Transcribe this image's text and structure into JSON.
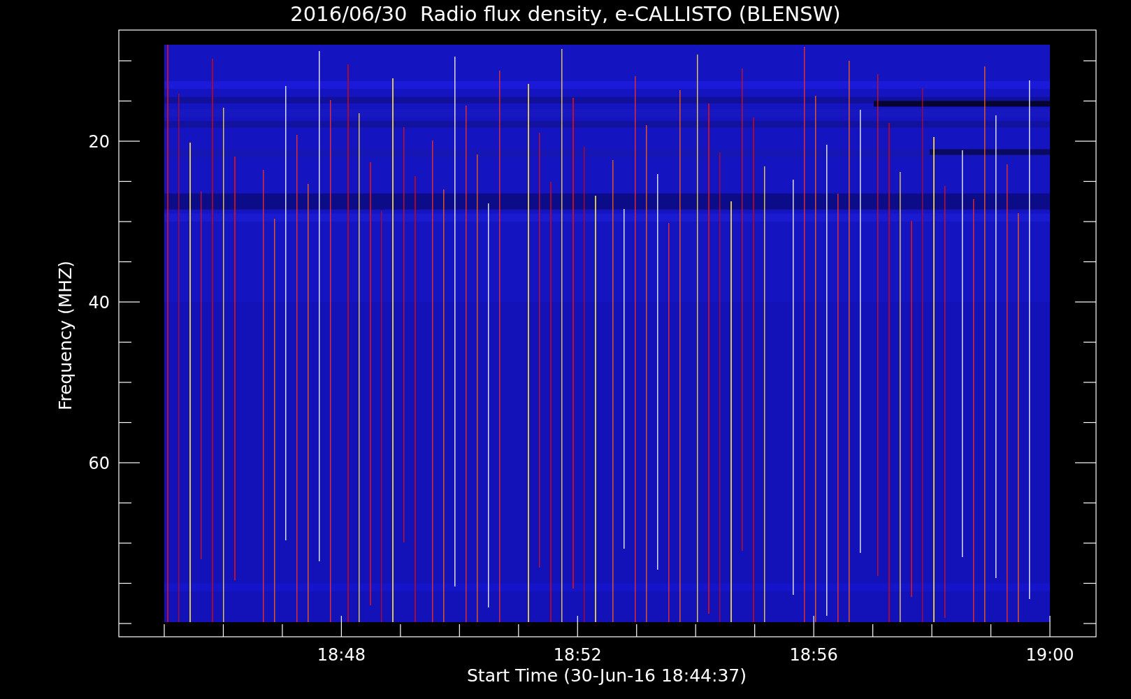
{
  "title": "2016/06/30  Radio flux density, e-CALLISTO (BLENSW)",
  "plot": {
    "ylabel": "Frequency (MHZ)",
    "xlabel": "Start Time (30-Jun-16 18:44:37)",
    "yticks": [
      "20",
      "40",
      "60"
    ],
    "xticks": [
      "18:48",
      "18:52",
      "18:56",
      "19:00"
    ]
  }
}
